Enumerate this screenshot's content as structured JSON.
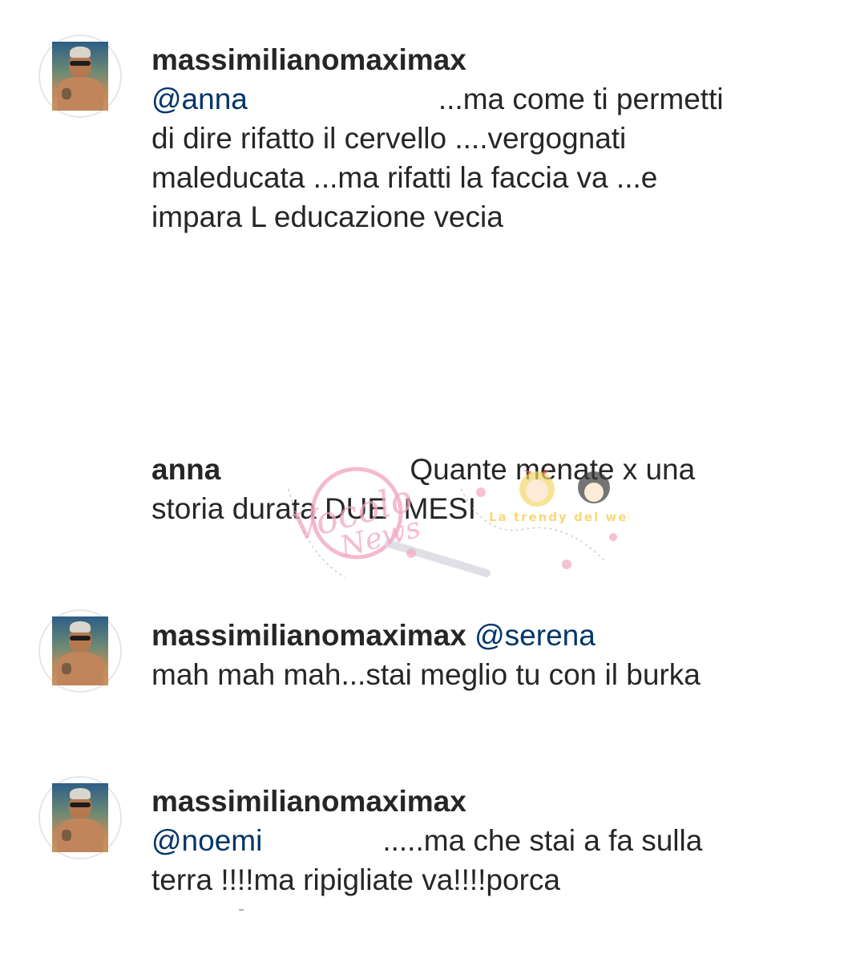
{
  "comments": [
    {
      "username": "massimilianomaximax",
      "mention": "@anna",
      "text_first": "...ma come ti permetti",
      "text_rest": "di dire rifatto il cervello ....vergognati\nmaleducata ...ma rifatti la faccia va ...e\nimpara L educazione vecia"
    },
    {
      "username": "anna",
      "text_first": "Quante menate x una",
      "text_rest": "storia durata DUE  MESI"
    },
    {
      "username": "massimilianomaximax",
      "mention": "@serena",
      "text": "mah mah mah...stai meglio tu con il burka"
    },
    {
      "username": "massimilianomaximax",
      "mention": "@noemi",
      "text_first": ".....ma che stai a fa sulla",
      "text_rest": "terra !!!!ma ripigliate va!!!!porca"
    }
  ],
  "watermark": {
    "brand": "Vocolo News",
    "tagline": "La trendy del web"
  },
  "colors": {
    "text": "#262626",
    "mention": "#003569",
    "watermark_pink": "#f2a7c3",
    "watermark_yellow": "#f5c842"
  }
}
